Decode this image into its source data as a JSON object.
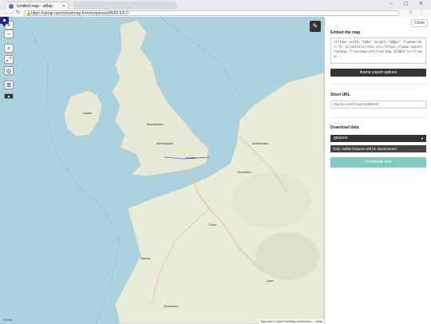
{
  "browser": {
    "tab_active_title": "Untitled map - uMap",
    "tab_inactive_title": "",
    "url": "https://umap.openstreetmap.fr/en/map/new/#6/50.5/0.0",
    "nav": {
      "back": "←",
      "forward": "→",
      "reload": "↻"
    },
    "window_controls": "– ▢ ✕"
  },
  "map": {
    "zoom_in": "+",
    "zoom_out": "−",
    "edit_icon": "pencil-icon",
    "cities": [
      {
        "name": "Dublin"
      },
      {
        "name": "London"
      },
      {
        "name": "Paris"
      },
      {
        "name": "Amsterdam"
      },
      {
        "name": "Bruxelles"
      },
      {
        "name": "Manchester"
      },
      {
        "name": "Birmingham"
      },
      {
        "name": "Nantes"
      },
      {
        "name": "Lyon"
      },
      {
        "name": "Bordeaux"
      }
    ],
    "attribution": "Map data © OpenStreetMap contributors — uMap",
    "scale_label": "100 km"
  },
  "panel": {
    "close_label": "Close",
    "embed_heading": "Embed the map",
    "embed_code": "<iframe width=\"100%\" height=\"300px\" frameborder=\"0\" allowfullscreen src=\"https://umap.openstreetmap.fr/en/map/untitled-map_165003\"></iframe>",
    "iframe_options_label": "iframe export options",
    "short_url_heading": "Short URL",
    "short_url_value": "http://u.osmfr.org/m/165003/",
    "download_heading": "Download data",
    "format_value": "geojson",
    "note": "Only visible features will be downloaded.",
    "download_button": "Download data"
  }
}
